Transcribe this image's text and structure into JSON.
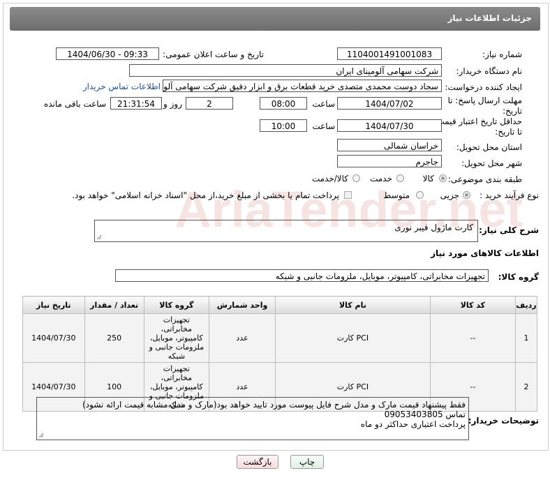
{
  "header": {
    "title": "جزئیات اطلاعات نیاز"
  },
  "fields": {
    "need_number": {
      "label": "شماره نیاز:",
      "value": "1104001491001083"
    },
    "announce_datetime": {
      "label": "تاریخ و ساعت اعلان عمومی:",
      "value": "1404/06/30 - 09:33"
    },
    "buyer_org": {
      "label": "نام دستگاه خریدار:",
      "value": "شرکت سهامی آلومینای ایران"
    },
    "requester": {
      "label": "ایجاد کننده درخواست:",
      "value": "سجاد دوست محمدی متصدی خرید قطعات برق و ابزار دقیق شرکت سهامی آلومینای ایران",
      "contact_link": "اطلاعات تماس خریدار"
    },
    "deadline": {
      "label_line1": "مهلت ارسال پاسخ: تا",
      "label_line2": "تاریخ:",
      "date": "1404/07/02",
      "time_label": "ساعت",
      "time": "08:00",
      "days": "2",
      "days_label": "روز و",
      "remaining": "21:31:54",
      "remaining_label": "ساعت باقی مانده"
    },
    "validity": {
      "label_line1": "حداقل تاریخ اعتبار قیمت:",
      "label_line2": "تا تاریخ:",
      "date": "1404/07/30",
      "time_label": "ساعت",
      "time": "10:00"
    },
    "province": {
      "label": "استان محل تحویل:",
      "value": "خراسان شمالی"
    },
    "city": {
      "label": "شهر محل تحویل:",
      "value": "جاجرم"
    },
    "category": {
      "label": "طبقه بندی موضوعی:",
      "options": [
        "کالا",
        "خدمت",
        "کالا/خدمت"
      ],
      "selected": "کالا"
    },
    "process": {
      "label": "نوع فرآیند خرید :",
      "options": [
        "جزیی",
        "متوسط"
      ],
      "selected": "جزیی",
      "note": "پرداخت تمام یا بخشی از مبلغ خرید،از محل \"اسناد خزانه اسلامی\" خواهد بود."
    }
  },
  "summary": {
    "label": "شرح کلی نیاز:",
    "value": "کارت ماژول فیبر نوری"
  },
  "goods_section": {
    "title": "اطلاعات کالاهای مورد نیاز",
    "group_label": "گروه کالا:",
    "group_value": "تجهیزات مخابراتی، کامپیوتر، موبایل، ملزومات جانبی و شبکه"
  },
  "table": {
    "headers": [
      "ردیف",
      "کد کالا",
      "نام کالا",
      "واحد شمارش",
      "گروه کالا",
      "تعداد / مقدار",
      "تاریخ نیاز"
    ],
    "rows": [
      {
        "index": "1",
        "code": "--",
        "name": "کارت PCI",
        "unit": "عدد",
        "group": "تجهیزات مخابراتی، کامپیوتر، موبایل، ملزومات جانبی و شبکه",
        "qty": "250",
        "date": "1404/07/30"
      },
      {
        "index": "2",
        "code": "--",
        "name": "کارت PCI",
        "unit": "عدد",
        "group": "تجهیزات مخابراتی، کامپیوتر، موبایل، ملزومات جانبی و شبکه",
        "qty": "100",
        "date": "1404/07/30"
      }
    ]
  },
  "buyer_notes": {
    "label": "توضیحات خریدار:",
    "line1": "فقط پیشنهاد قیمت مارک و مدل شرح فایل پیوست مورد تایید خواهد بود(مارک و مدل مشابه قیمت ارائه نشود)",
    "line2": "تماس 09053403805",
    "line3": "پرداخت اعتباری حداکثر دو ماه"
  },
  "buttons": {
    "print": "چاپ",
    "back": "بازگشت"
  },
  "watermark": {
    "text": "AriaTender.net"
  },
  "colors": {
    "title_bar": "#7a7a7a",
    "link": "#1a4fa0",
    "back_button": "#fbe4e4",
    "print_button": "#eef7ee"
  }
}
